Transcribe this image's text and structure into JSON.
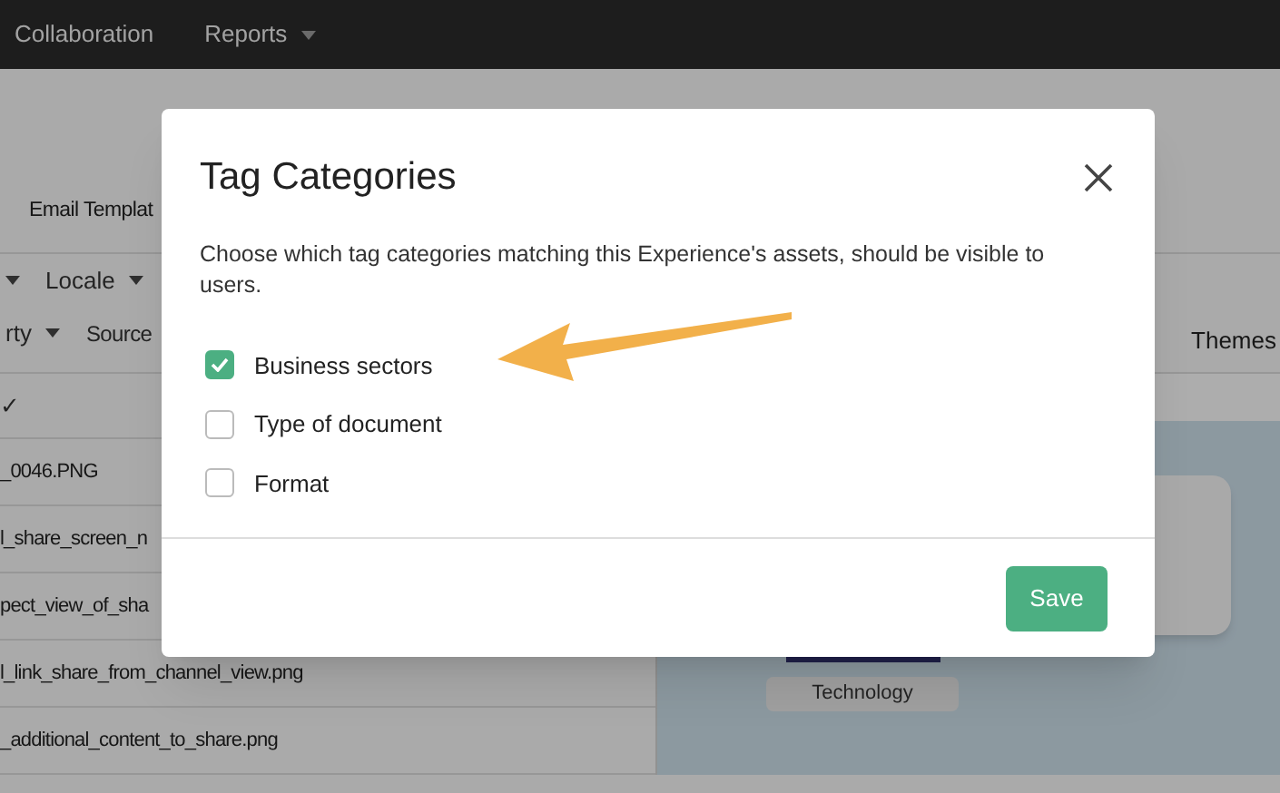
{
  "nav": {
    "items": [
      {
        "label": "Collaboration",
        "has_menu": false
      },
      {
        "label": "Reports",
        "has_menu": true
      }
    ]
  },
  "page_tabs": [
    {
      "label": "Email Templat"
    }
  ],
  "filters": [
    [
      {
        "kind": "caret"
      },
      {
        "kind": "dropdown",
        "label": "Locale"
      }
    ],
    [
      {
        "kind": "dropdown",
        "label": "rty"
      },
      {
        "kind": "label",
        "label": "Source"
      }
    ]
  ],
  "file_list": {
    "header_mark": "✓",
    "rows": [
      "_0046.PNG",
      "l_share_screen_n",
      "pect_view_of_sha",
      "l_link_share_from_channel_view.png",
      "_additional_content_to_share.png"
    ]
  },
  "right_panel": {
    "tab": "Themes",
    "cards": [
      {
        "label": "Technology"
      }
    ]
  },
  "dialog": {
    "title": "Tag Categories",
    "description": "Choose which tag categories matching this Experience's assets, should be visible to users.",
    "options": [
      {
        "label": "Business sectors",
        "checked": true
      },
      {
        "label": "Type of document",
        "checked": false
      },
      {
        "label": "Format",
        "checked": false
      }
    ],
    "save_button": "Save"
  }
}
